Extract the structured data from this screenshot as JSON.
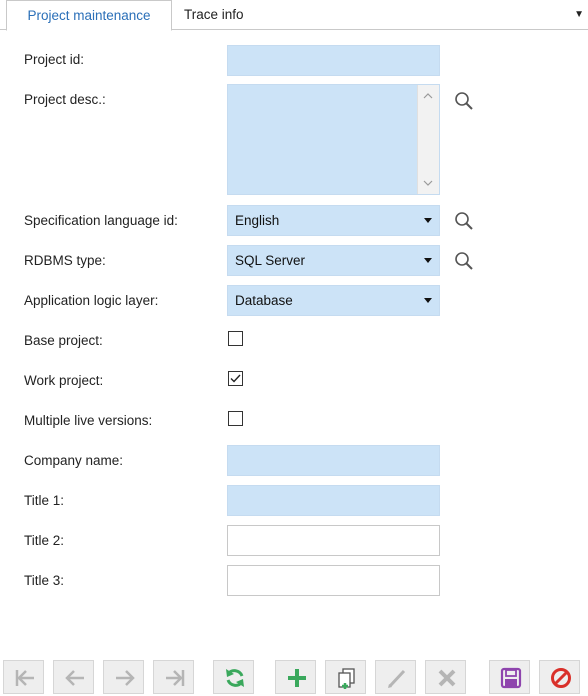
{
  "tabs": [
    {
      "label": "Project maintenance",
      "active": true
    },
    {
      "label": "Trace info",
      "active": false
    }
  ],
  "form": {
    "project_id": {
      "label": "Project id:",
      "value": ""
    },
    "project_desc": {
      "label": "Project desc.:",
      "value": ""
    },
    "spec_language": {
      "label": "Specification language id:",
      "value": "English"
    },
    "rdbms_type": {
      "label": "RDBMS type:",
      "value": "SQL Server"
    },
    "app_logic_layer": {
      "label": "Application logic layer:",
      "value": "Database"
    },
    "base_project": {
      "label": "Base project:",
      "checked": false
    },
    "work_project": {
      "label": "Work project:",
      "checked": true
    },
    "multiple_live_versions": {
      "label": "Multiple live versions:",
      "checked": false
    },
    "company_name": {
      "label": "Company name:",
      "value": ""
    },
    "title1": {
      "label": "Title 1:",
      "value": ""
    },
    "title2": {
      "label": "Title 2:",
      "value": ""
    },
    "title3": {
      "label": "Title 3:",
      "value": ""
    }
  },
  "toolbar": {
    "buttons": [
      {
        "name": "first-record",
        "icon": "first-icon",
        "enabled": false
      },
      {
        "name": "previous-record",
        "icon": "arrow-left-icon",
        "enabled": false
      },
      {
        "name": "next-record",
        "icon": "arrow-right-icon",
        "enabled": false
      },
      {
        "name": "last-record",
        "icon": "last-icon",
        "enabled": false
      },
      {
        "name": "refresh",
        "icon": "refresh-icon",
        "enabled": true
      },
      {
        "name": "add",
        "icon": "plus-icon",
        "enabled": true
      },
      {
        "name": "copy",
        "icon": "copy-icon",
        "enabled": true
      },
      {
        "name": "edit",
        "icon": "pencil-icon",
        "enabled": false
      },
      {
        "name": "delete",
        "icon": "delete-icon",
        "enabled": false
      },
      {
        "name": "save",
        "icon": "save-icon",
        "enabled": true
      },
      {
        "name": "cancel",
        "icon": "cancel-icon",
        "enabled": true
      }
    ]
  },
  "colors": {
    "field_bg": "#cce3f7",
    "active_tab_text": "#2a6fb8",
    "refresh_green": "#3aa85c",
    "save_purple": "#8e44ad",
    "cancel_red": "#d9302a"
  }
}
